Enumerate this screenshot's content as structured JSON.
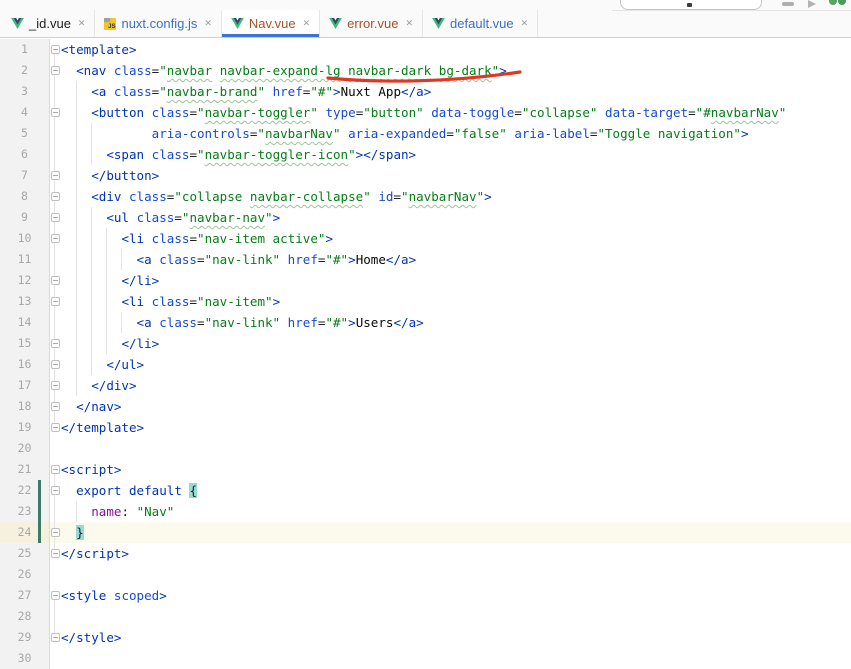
{
  "tabs": [
    {
      "label": "_id.vue",
      "icon": "vue",
      "status": "normal",
      "active": false
    },
    {
      "label": "nuxt.config.js",
      "icon": "js",
      "status": "modified",
      "active": false
    },
    {
      "label": "Nav.vue",
      "icon": "vue",
      "status": "unversioned",
      "active": true
    },
    {
      "label": "error.vue",
      "icon": "vue",
      "status": "unversioned",
      "active": false
    },
    {
      "label": "default.vue",
      "icon": "vue",
      "status": "modified",
      "active": false
    }
  ],
  "tab_close_glyph": "✕",
  "colors": {
    "tag": "#0033B3",
    "attribute": "#174AD4",
    "string": "#067D17",
    "property": "#871094",
    "keyword": "#0033B3",
    "body_text": "#080808",
    "typo_wave": "#9DC49B",
    "tab_active_underline": "#3B74D9",
    "tab_modified": "#3C6EC6",
    "tab_unversioned": "#A6512B",
    "caret_line_bg": "#FCFAED",
    "brace_match_bg": "#96DBD3",
    "change_marker": "#3A7A6B",
    "annotation_red": "#E23522",
    "gutter_bg": "#F2F2F2",
    "vue_green": "#41B883",
    "vue_dark": "#34495E"
  },
  "editor": {
    "current_line": 24,
    "change_marker": {
      "from_line": 22,
      "to_line": 24
    },
    "annotation": {
      "type": "red-underline",
      "under_text": "navbar-dark bg-dark"
    },
    "lines": [
      {
        "n": 1,
        "fold": "s",
        "segs": [
          [
            "t",
            "<template>"
          ]
        ]
      },
      {
        "n": 2,
        "fold": "s",
        "segs": [
          [
            "p",
            "  "
          ],
          [
            "t",
            "<nav"
          ],
          [
            "p",
            " "
          ],
          [
            "a",
            "class"
          ],
          [
            "q",
            "="
          ],
          [
            "s",
            "\""
          ],
          [
            "w",
            "navbar"
          ],
          [
            "s",
            " "
          ],
          [
            "w",
            "navbar-expand-lg"
          ],
          [
            "s",
            " "
          ],
          [
            "w",
            "navbar-dark"
          ],
          [
            "s",
            " "
          ],
          [
            "w",
            "bg-dark"
          ],
          [
            "s",
            "\""
          ],
          [
            "t",
            ">"
          ]
        ]
      },
      {
        "n": 3,
        "segs": [
          [
            "p",
            "    "
          ],
          [
            "t",
            "<a"
          ],
          [
            "p",
            " "
          ],
          [
            "a",
            "class"
          ],
          [
            "q",
            "="
          ],
          [
            "s",
            "\""
          ],
          [
            "w",
            "navbar-brand"
          ],
          [
            "s",
            "\""
          ],
          [
            "p",
            " "
          ],
          [
            "a",
            "href"
          ],
          [
            "q",
            "="
          ],
          [
            "s",
            "\"#\""
          ],
          [
            "t",
            ">"
          ],
          [
            "x",
            "Nuxt App"
          ],
          [
            "t",
            "</a>"
          ]
        ]
      },
      {
        "n": 4,
        "fold": "s",
        "segs": [
          [
            "p",
            "    "
          ],
          [
            "t",
            "<button"
          ],
          [
            "p",
            " "
          ],
          [
            "a",
            "class"
          ],
          [
            "q",
            "="
          ],
          [
            "s",
            "\""
          ],
          [
            "w",
            "navbar-toggler"
          ],
          [
            "s",
            "\""
          ],
          [
            "p",
            " "
          ],
          [
            "a",
            "type"
          ],
          [
            "q",
            "="
          ],
          [
            "s",
            "\"button\""
          ],
          [
            "p",
            " "
          ],
          [
            "a",
            "data-toggle"
          ],
          [
            "q",
            "="
          ],
          [
            "s",
            "\"collapse\""
          ],
          [
            "p",
            " "
          ],
          [
            "a",
            "data-target"
          ],
          [
            "q",
            "="
          ],
          [
            "s",
            "\"#"
          ],
          [
            "w",
            "navbarNav"
          ],
          [
            "s",
            "\""
          ]
        ]
      },
      {
        "n": 5,
        "segs": [
          [
            "p",
            "            "
          ],
          [
            "a",
            "aria-controls"
          ],
          [
            "q",
            "="
          ],
          [
            "s",
            "\""
          ],
          [
            "w",
            "navbarNav"
          ],
          [
            "s",
            "\""
          ],
          [
            "p",
            " "
          ],
          [
            "a",
            "aria-expanded"
          ],
          [
            "q",
            "="
          ],
          [
            "s",
            "\"false\""
          ],
          [
            "p",
            " "
          ],
          [
            "a",
            "aria-label"
          ],
          [
            "q",
            "="
          ],
          [
            "s",
            "\"Toggle navigation\""
          ],
          [
            "t",
            ">"
          ]
        ]
      },
      {
        "n": 6,
        "segs": [
          [
            "p",
            "      "
          ],
          [
            "t",
            "<span"
          ],
          [
            "p",
            " "
          ],
          [
            "a",
            "class"
          ],
          [
            "q",
            "="
          ],
          [
            "s",
            "\""
          ],
          [
            "w",
            "navbar-toggler-icon"
          ],
          [
            "s",
            "\""
          ],
          [
            "t",
            "></span>"
          ]
        ]
      },
      {
        "n": 7,
        "fold": "e",
        "segs": [
          [
            "p",
            "    "
          ],
          [
            "t",
            "</button>"
          ]
        ]
      },
      {
        "n": 8,
        "fold": "s",
        "segs": [
          [
            "p",
            "    "
          ],
          [
            "t",
            "<div"
          ],
          [
            "p",
            " "
          ],
          [
            "a",
            "class"
          ],
          [
            "q",
            "="
          ],
          [
            "s",
            "\"collapse "
          ],
          [
            "w",
            "navbar-collapse"
          ],
          [
            "s",
            "\""
          ],
          [
            "p",
            " "
          ],
          [
            "a",
            "id"
          ],
          [
            "q",
            "="
          ],
          [
            "s",
            "\""
          ],
          [
            "w",
            "navbarNav"
          ],
          [
            "s",
            "\""
          ],
          [
            "t",
            ">"
          ]
        ]
      },
      {
        "n": 9,
        "fold": "s",
        "segs": [
          [
            "p",
            "      "
          ],
          [
            "t",
            "<ul"
          ],
          [
            "p",
            " "
          ],
          [
            "a",
            "class"
          ],
          [
            "q",
            "="
          ],
          [
            "s",
            "\""
          ],
          [
            "w",
            "navbar-nav"
          ],
          [
            "s",
            "\""
          ],
          [
            "t",
            ">"
          ]
        ]
      },
      {
        "n": 10,
        "fold": "s",
        "segs": [
          [
            "p",
            "        "
          ],
          [
            "t",
            "<li"
          ],
          [
            "p",
            " "
          ],
          [
            "a",
            "class"
          ],
          [
            "q",
            "="
          ],
          [
            "s",
            "\"nav-item active\""
          ],
          [
            "t",
            ">"
          ]
        ]
      },
      {
        "n": 11,
        "segs": [
          [
            "p",
            "          "
          ],
          [
            "t",
            "<a"
          ],
          [
            "p",
            " "
          ],
          [
            "a",
            "class"
          ],
          [
            "q",
            "="
          ],
          [
            "s",
            "\"nav-link\""
          ],
          [
            "p",
            " "
          ],
          [
            "a",
            "href"
          ],
          [
            "q",
            "="
          ],
          [
            "s",
            "\"#\""
          ],
          [
            "t",
            ">"
          ],
          [
            "x",
            "Home"
          ],
          [
            "t",
            "</a>"
          ]
        ]
      },
      {
        "n": 12,
        "fold": "e",
        "segs": [
          [
            "p",
            "        "
          ],
          [
            "t",
            "</li>"
          ]
        ]
      },
      {
        "n": 13,
        "fold": "s",
        "segs": [
          [
            "p",
            "        "
          ],
          [
            "t",
            "<li"
          ],
          [
            "p",
            " "
          ],
          [
            "a",
            "class"
          ],
          [
            "q",
            "="
          ],
          [
            "s",
            "\"nav-item\""
          ],
          [
            "t",
            ">"
          ]
        ]
      },
      {
        "n": 14,
        "segs": [
          [
            "p",
            "          "
          ],
          [
            "t",
            "<a"
          ],
          [
            "p",
            " "
          ],
          [
            "a",
            "class"
          ],
          [
            "q",
            "="
          ],
          [
            "s",
            "\"nav-link\""
          ],
          [
            "p",
            " "
          ],
          [
            "a",
            "href"
          ],
          [
            "q",
            "="
          ],
          [
            "s",
            "\"#\""
          ],
          [
            "t",
            ">"
          ],
          [
            "x",
            "Users"
          ],
          [
            "t",
            "</a>"
          ]
        ]
      },
      {
        "n": 15,
        "fold": "e",
        "segs": [
          [
            "p",
            "        "
          ],
          [
            "t",
            "</li>"
          ]
        ]
      },
      {
        "n": 16,
        "fold": "e",
        "segs": [
          [
            "p",
            "      "
          ],
          [
            "t",
            "</ul>"
          ]
        ]
      },
      {
        "n": 17,
        "fold": "e",
        "segs": [
          [
            "p",
            "    "
          ],
          [
            "t",
            "</div>"
          ]
        ]
      },
      {
        "n": 18,
        "fold": "e",
        "segs": [
          [
            "p",
            "  "
          ],
          [
            "t",
            "</nav>"
          ]
        ]
      },
      {
        "n": 19,
        "fold": "e",
        "segs": [
          [
            "t",
            "</template>"
          ]
        ]
      },
      {
        "n": 20,
        "segs": []
      },
      {
        "n": 21,
        "fold": "s",
        "segs": [
          [
            "t",
            "<script>"
          ]
        ]
      },
      {
        "n": 22,
        "fold": "s",
        "segs": [
          [
            "p",
            "  "
          ],
          [
            "k",
            "export"
          ],
          [
            "p",
            " "
          ],
          [
            "k",
            "default"
          ],
          [
            "p",
            " "
          ],
          [
            "b",
            "{"
          ]
        ]
      },
      {
        "n": 23,
        "segs": [
          [
            "p",
            "    "
          ],
          [
            "r",
            "name"
          ],
          [
            "q",
            ":"
          ],
          [
            "p",
            " "
          ],
          [
            "s",
            "\"Nav\""
          ]
        ]
      },
      {
        "n": 24,
        "fold": "e",
        "segs": [
          [
            "p",
            "  "
          ],
          [
            "b",
            "}"
          ]
        ]
      },
      {
        "n": 25,
        "fold": "e",
        "segs": [
          [
            "t",
            "</script>"
          ]
        ]
      },
      {
        "n": 26,
        "segs": []
      },
      {
        "n": 27,
        "fold": "s",
        "segs": [
          [
            "t",
            "<style"
          ],
          [
            "p",
            " "
          ],
          [
            "a",
            "scoped"
          ],
          [
            "t",
            ">"
          ]
        ]
      },
      {
        "n": 28,
        "segs": []
      },
      {
        "n": 29,
        "fold": "e",
        "segs": [
          [
            "t",
            "</style>"
          ]
        ]
      },
      {
        "n": 30,
        "segs": []
      }
    ]
  }
}
